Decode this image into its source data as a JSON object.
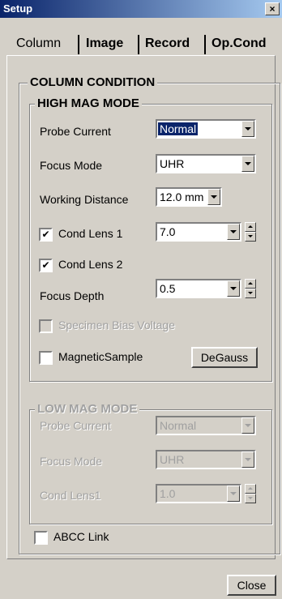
{
  "window": {
    "title": "Setup",
    "close_glyph": "×"
  },
  "tabs": [
    {
      "label": "Column",
      "active": true
    },
    {
      "label": "Image"
    },
    {
      "label": "Record"
    },
    {
      "label": "Op.Cond"
    }
  ],
  "column_condition": {
    "title": "COLUMN CONDITION",
    "high_mag": {
      "title": "HIGH MAG MODE",
      "probe_current": {
        "label": "Probe Current",
        "value": "Normal"
      },
      "focus_mode": {
        "label": "Focus Mode",
        "value": "UHR"
      },
      "working_distance": {
        "label": "Working Distance",
        "value": "12.0 mm"
      },
      "cond_lens1": {
        "label": "Cond Lens 1",
        "value": "7.0",
        "checked": true
      },
      "cond_lens2": {
        "label": "Cond Lens 2",
        "checked": true
      },
      "focus_depth": {
        "label": "Focus Depth",
        "value": "0.5"
      },
      "specimen_bias": {
        "label": "Specimen Bias Voltage",
        "enabled": false
      },
      "magnetic_sample": {
        "label": "MagneticSample",
        "checked": false
      },
      "degauss_button": "DeGauss"
    },
    "low_mag": {
      "title": "LOW MAG MODE",
      "probe_current": {
        "label": "Probe Current",
        "value": "Normal"
      },
      "focus_mode": {
        "label": "Focus Mode",
        "value": "UHR"
      },
      "cond_lens1": {
        "label": "Cond Lens1",
        "value": "1.0"
      }
    },
    "abcc_link": {
      "label": "ABCC Link",
      "checked": false
    }
  },
  "close_button": "Close",
  "check_glyph": "✔"
}
